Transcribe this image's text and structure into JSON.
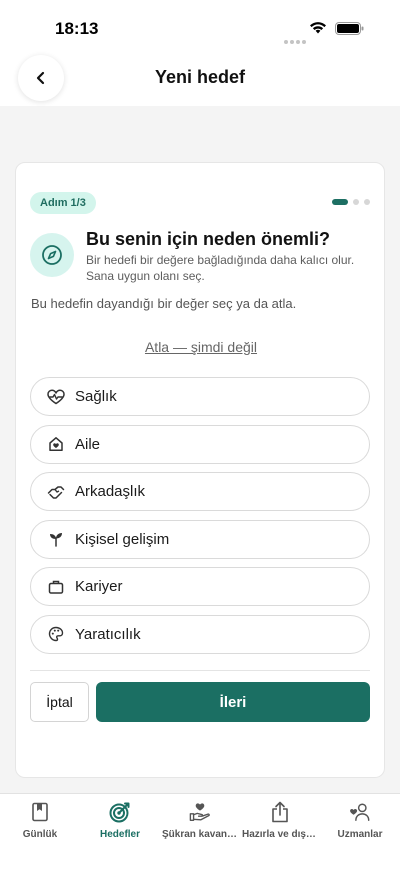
{
  "status_bar": {
    "time": "18:13"
  },
  "header": {
    "title": "Yeni hedef"
  },
  "card": {
    "step_badge": "Adım 1/3",
    "progress": {
      "total_steps": 3,
      "current_step": 1
    },
    "question_title": "Bu senin için neden önemli?",
    "question_description": "Bir hedefi bir değere bağladığında daha kalıcı olur. Sana uygun olanı seç.",
    "instruction": "Bu hedefin dayandığı bir değer seç ya da atla.",
    "skip_label": "Atla — şimdi değil",
    "options": [
      {
        "label": "Sağlık",
        "icon": "heart-pulse-icon"
      },
      {
        "label": "Aile",
        "icon": "home-heart-icon"
      },
      {
        "label": "Arkadaşlık",
        "icon": "handshake-icon"
      },
      {
        "label": "Kişisel gelişim",
        "icon": "sprout-icon"
      },
      {
        "label": "Kariyer",
        "icon": "briefcase-icon"
      },
      {
        "label": "Yaratıcılık",
        "icon": "palette-icon"
      }
    ],
    "cancel_label": "İptal",
    "next_label": "İleri"
  },
  "tabs": [
    {
      "label": "Günlük",
      "icon": "book-icon",
      "active": false
    },
    {
      "label": "Hedefler",
      "icon": "target-icon",
      "active": true
    },
    {
      "label": "Şükran kavanozu",
      "icon": "hand-heart-icon",
      "active": false
    },
    {
      "label": "Hazırla ve dışa aktar",
      "icon": "share-icon",
      "active": false
    },
    {
      "label": "Uzmanlar",
      "icon": "user-heart-icon",
      "active": false
    }
  ],
  "colors": {
    "accent": "#1b6f63",
    "badge_bg": "#d3f5ec",
    "background": "#f4f4f4"
  }
}
